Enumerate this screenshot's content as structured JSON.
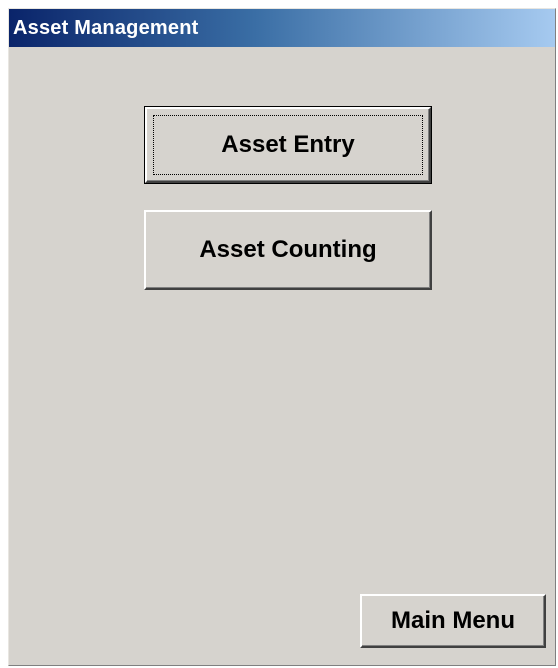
{
  "window": {
    "title": "Asset Management"
  },
  "buttons": {
    "asset_entry": "Asset Entry",
    "asset_counting": "Asset Counting",
    "main_menu": "Main Menu"
  },
  "colors": {
    "title_bar_start": "#0a246a",
    "title_bar_end": "#a6caf0",
    "window_background": "#d6d3ce",
    "title_text": "#ffffff"
  }
}
